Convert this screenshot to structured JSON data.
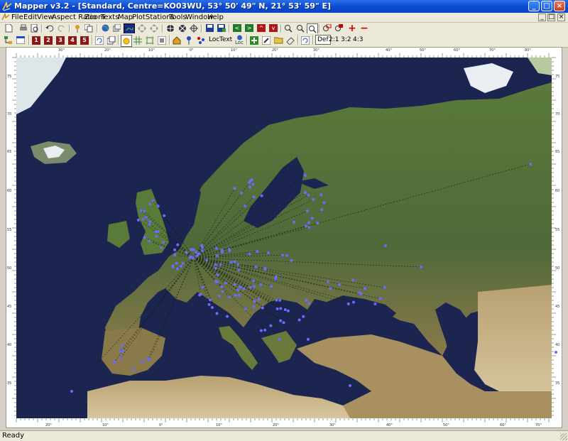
{
  "window": {
    "title": "Mapper v3.2 - [Standard, Centre=KO03WU, 53° 50' 49\" N, 21° 53' 59\" E]",
    "controls": [
      "_",
      "□",
      "×"
    ]
  },
  "menu": {
    "items": [
      "File",
      "Edit",
      "View",
      "Aspect Ratio",
      "Zoom",
      "Texts",
      "Map",
      "Plot",
      "Stations",
      "Tools",
      "Window",
      "Help"
    ],
    "mdi_controls": [
      "_",
      "□",
      "×"
    ]
  },
  "toolbar2": {
    "numbers": [
      "1",
      "2",
      "3",
      "4",
      "5"
    ],
    "loc_label": "Loc",
    "text_label": "Text",
    "loc_sub": "Loc",
    "aspect_labels": [
      "Def",
      "2:1",
      "3:2",
      "4:3"
    ]
  },
  "map": {
    "top_ticks": [
      "30°",
      "20°",
      "10°",
      "0°",
      "10°",
      "20°",
      "30°",
      "40°",
      "50°",
      "60°",
      "70°",
      "80°"
    ],
    "bottom_ticks": [
      "20°",
      "10°",
      "0°",
      "10°",
      "20°",
      "30°",
      "40°",
      "50°",
      "60°",
      "70°"
    ],
    "left_ticks": [
      "75",
      "70",
      "65",
      "60",
      "55",
      "50",
      "45",
      "40",
      "35"
    ],
    "right_ticks": [
      "75",
      "70",
      "65",
      "60",
      "55",
      "50",
      "45",
      "40",
      "35"
    ],
    "colors": {
      "sea": "#1c2450",
      "land": "#4e6a33",
      "ice": "#e8eef2",
      "station": "#6a6cff"
    }
  },
  "status": {
    "text": "Ready"
  }
}
